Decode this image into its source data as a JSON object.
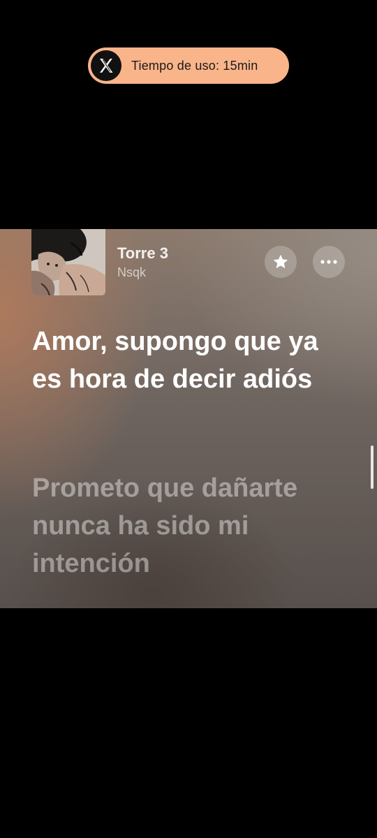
{
  "usage_pill": {
    "app_icon": "x-logo-icon",
    "text": "Tiempo de uso: 15min",
    "background": "#f9b48a"
  },
  "now_playing": {
    "title": "Torre 3",
    "artist": "Nsqk",
    "cover_icon": "album-cover"
  },
  "actions": {
    "favorite_icon": "star-icon",
    "more_icon": "more-dots-icon"
  },
  "lyrics": {
    "current": "Amor, supongo que ya es hora de decir adiós",
    "next": "Prometo que dañarte nunca ha sido mi intención"
  }
}
